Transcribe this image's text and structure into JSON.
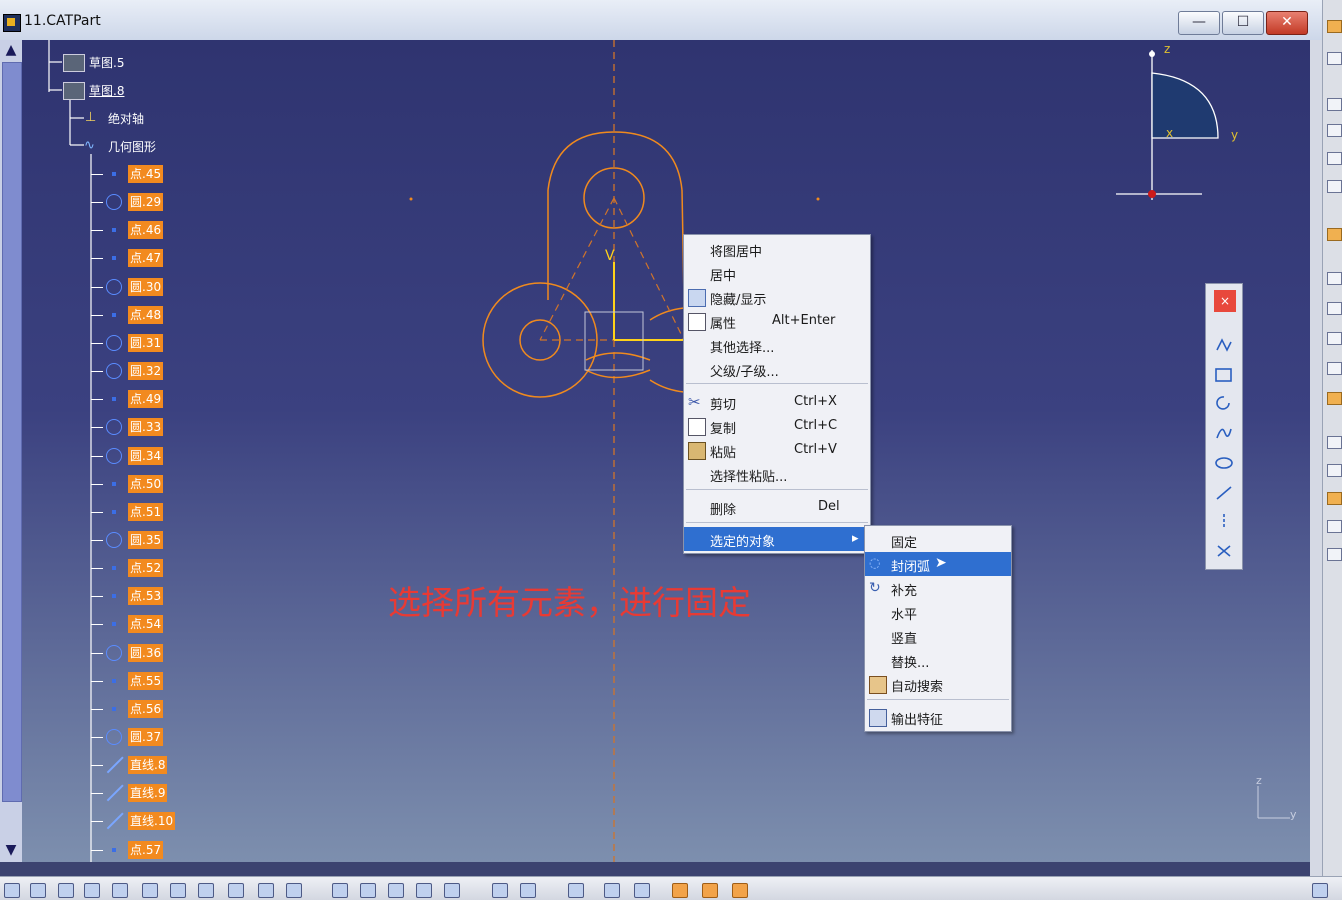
{
  "window": {
    "title": "11.CATPart",
    "minimize": "—",
    "maximize": "☐",
    "close": "✕"
  },
  "tree": {
    "cut_top": "— — —",
    "nodes": [
      {
        "label": "草图.5",
        "type": "sketch"
      },
      {
        "label": "草图.8",
        "type": "sketch"
      },
      {
        "label": "绝对轴",
        "type": "axis"
      },
      {
        "label": "几何图形",
        "type": "geometry"
      }
    ],
    "items": [
      {
        "label": "点.45",
        "kind": "point"
      },
      {
        "label": "圆.29",
        "kind": "circle"
      },
      {
        "label": "点.46",
        "kind": "point"
      },
      {
        "label": "点.47",
        "kind": "point"
      },
      {
        "label": "圆.30",
        "kind": "circle"
      },
      {
        "label": "点.48",
        "kind": "point"
      },
      {
        "label": "圆.31",
        "kind": "circle"
      },
      {
        "label": "圆.32",
        "kind": "circle"
      },
      {
        "label": "点.49",
        "kind": "point"
      },
      {
        "label": "圆.33",
        "kind": "circle"
      },
      {
        "label": "圆.34",
        "kind": "circle"
      },
      {
        "label": "点.50",
        "kind": "point"
      },
      {
        "label": "点.51",
        "kind": "point"
      },
      {
        "label": "圆.35",
        "kind": "circle"
      },
      {
        "label": "点.52",
        "kind": "point"
      },
      {
        "label": "点.53",
        "kind": "point"
      },
      {
        "label": "点.54",
        "kind": "point"
      },
      {
        "label": "圆.36",
        "kind": "circle"
      },
      {
        "label": "点.55",
        "kind": "point"
      },
      {
        "label": "点.56",
        "kind": "point"
      },
      {
        "label": "圆.37",
        "kind": "circle"
      },
      {
        "label": "直线.8",
        "kind": "line"
      },
      {
        "label": "直线.9",
        "kind": "line"
      },
      {
        "label": "直线.10",
        "kind": "line"
      },
      {
        "label": "点.57",
        "kind": "point"
      }
    ]
  },
  "context_menu": {
    "items": [
      {
        "label": "将图居中",
        "shortcut": ""
      },
      {
        "label": "居中",
        "shortcut": ""
      },
      {
        "label": "隐藏/显示",
        "shortcut": "",
        "icon": "hide-show-icon"
      },
      {
        "label": "属性",
        "shortcut": "Alt+Enter",
        "icon": "properties-icon"
      },
      {
        "label": "其他选择...",
        "shortcut": ""
      },
      {
        "label": "父级/子级...",
        "shortcut": ""
      },
      {
        "label": "剪切",
        "shortcut": "Ctrl+X",
        "icon": "scissors-icon"
      },
      {
        "label": "复制",
        "shortcut": "Ctrl+C",
        "icon": "copy-icon"
      },
      {
        "label": "粘贴",
        "shortcut": "Ctrl+V",
        "icon": "paste-icon"
      },
      {
        "label": "选择性粘贴...",
        "shortcut": ""
      },
      {
        "label": "删除",
        "shortcut": "Del"
      },
      {
        "label": "选定的对象",
        "shortcut": "",
        "submenu_arrow": "▸"
      }
    ]
  },
  "submenu": {
    "items": [
      {
        "label": "固定"
      },
      {
        "label": "封闭弧"
      },
      {
        "label": "补充"
      },
      {
        "label": "水平"
      },
      {
        "label": "竖直"
      },
      {
        "label": "替换..."
      },
      {
        "label": "自动搜索"
      },
      {
        "label": "输出特征"
      }
    ]
  },
  "caption": "选择所有元素，进行固定",
  "compass": {
    "z": "z",
    "y": "y",
    "x": "x"
  },
  "axis_corner": {
    "z": "z",
    "y": "y"
  },
  "floating_toolbar": {
    "close": "×"
  },
  "colors": {
    "sketch": "#f08a1e",
    "badge": "#f28a1f",
    "highlight": "#2f6fd0",
    "caption": "#e83a34"
  }
}
